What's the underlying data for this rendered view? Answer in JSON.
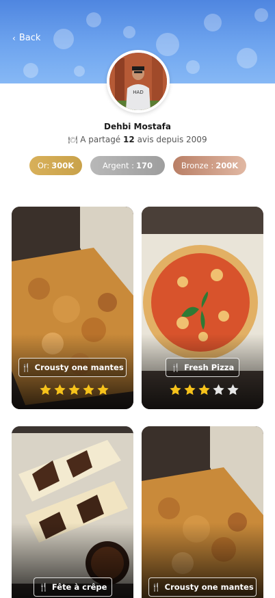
{
  "header": {
    "back_label": "Back"
  },
  "profile": {
    "name": "Dehbi Mostafa",
    "subtitle_prefix": "A partagé",
    "reviews_count": "12",
    "subtitle_suffix": "avis depuis 2009",
    "shirt_text": "HAD"
  },
  "badges": [
    {
      "label": "Or:",
      "value": "300K",
      "color": "#c9a64c"
    },
    {
      "label": "Argent :",
      "value": "170",
      "color": "#a8a8a8"
    },
    {
      "label": "Bronze :",
      "value": "200K",
      "color": "#c99a80"
    }
  ],
  "cards": [
    {
      "name": "Crousty one mantes",
      "rating": 5,
      "max": 5
    },
    {
      "name": "Fresh Pizza",
      "rating": 3,
      "max": 5
    },
    {
      "name": "Fête à crêpe"
    },
    {
      "name": "Crousty one mantes"
    }
  ],
  "colors": {
    "star_on": "#f6c21b",
    "star_off": "#e6e6e6"
  }
}
